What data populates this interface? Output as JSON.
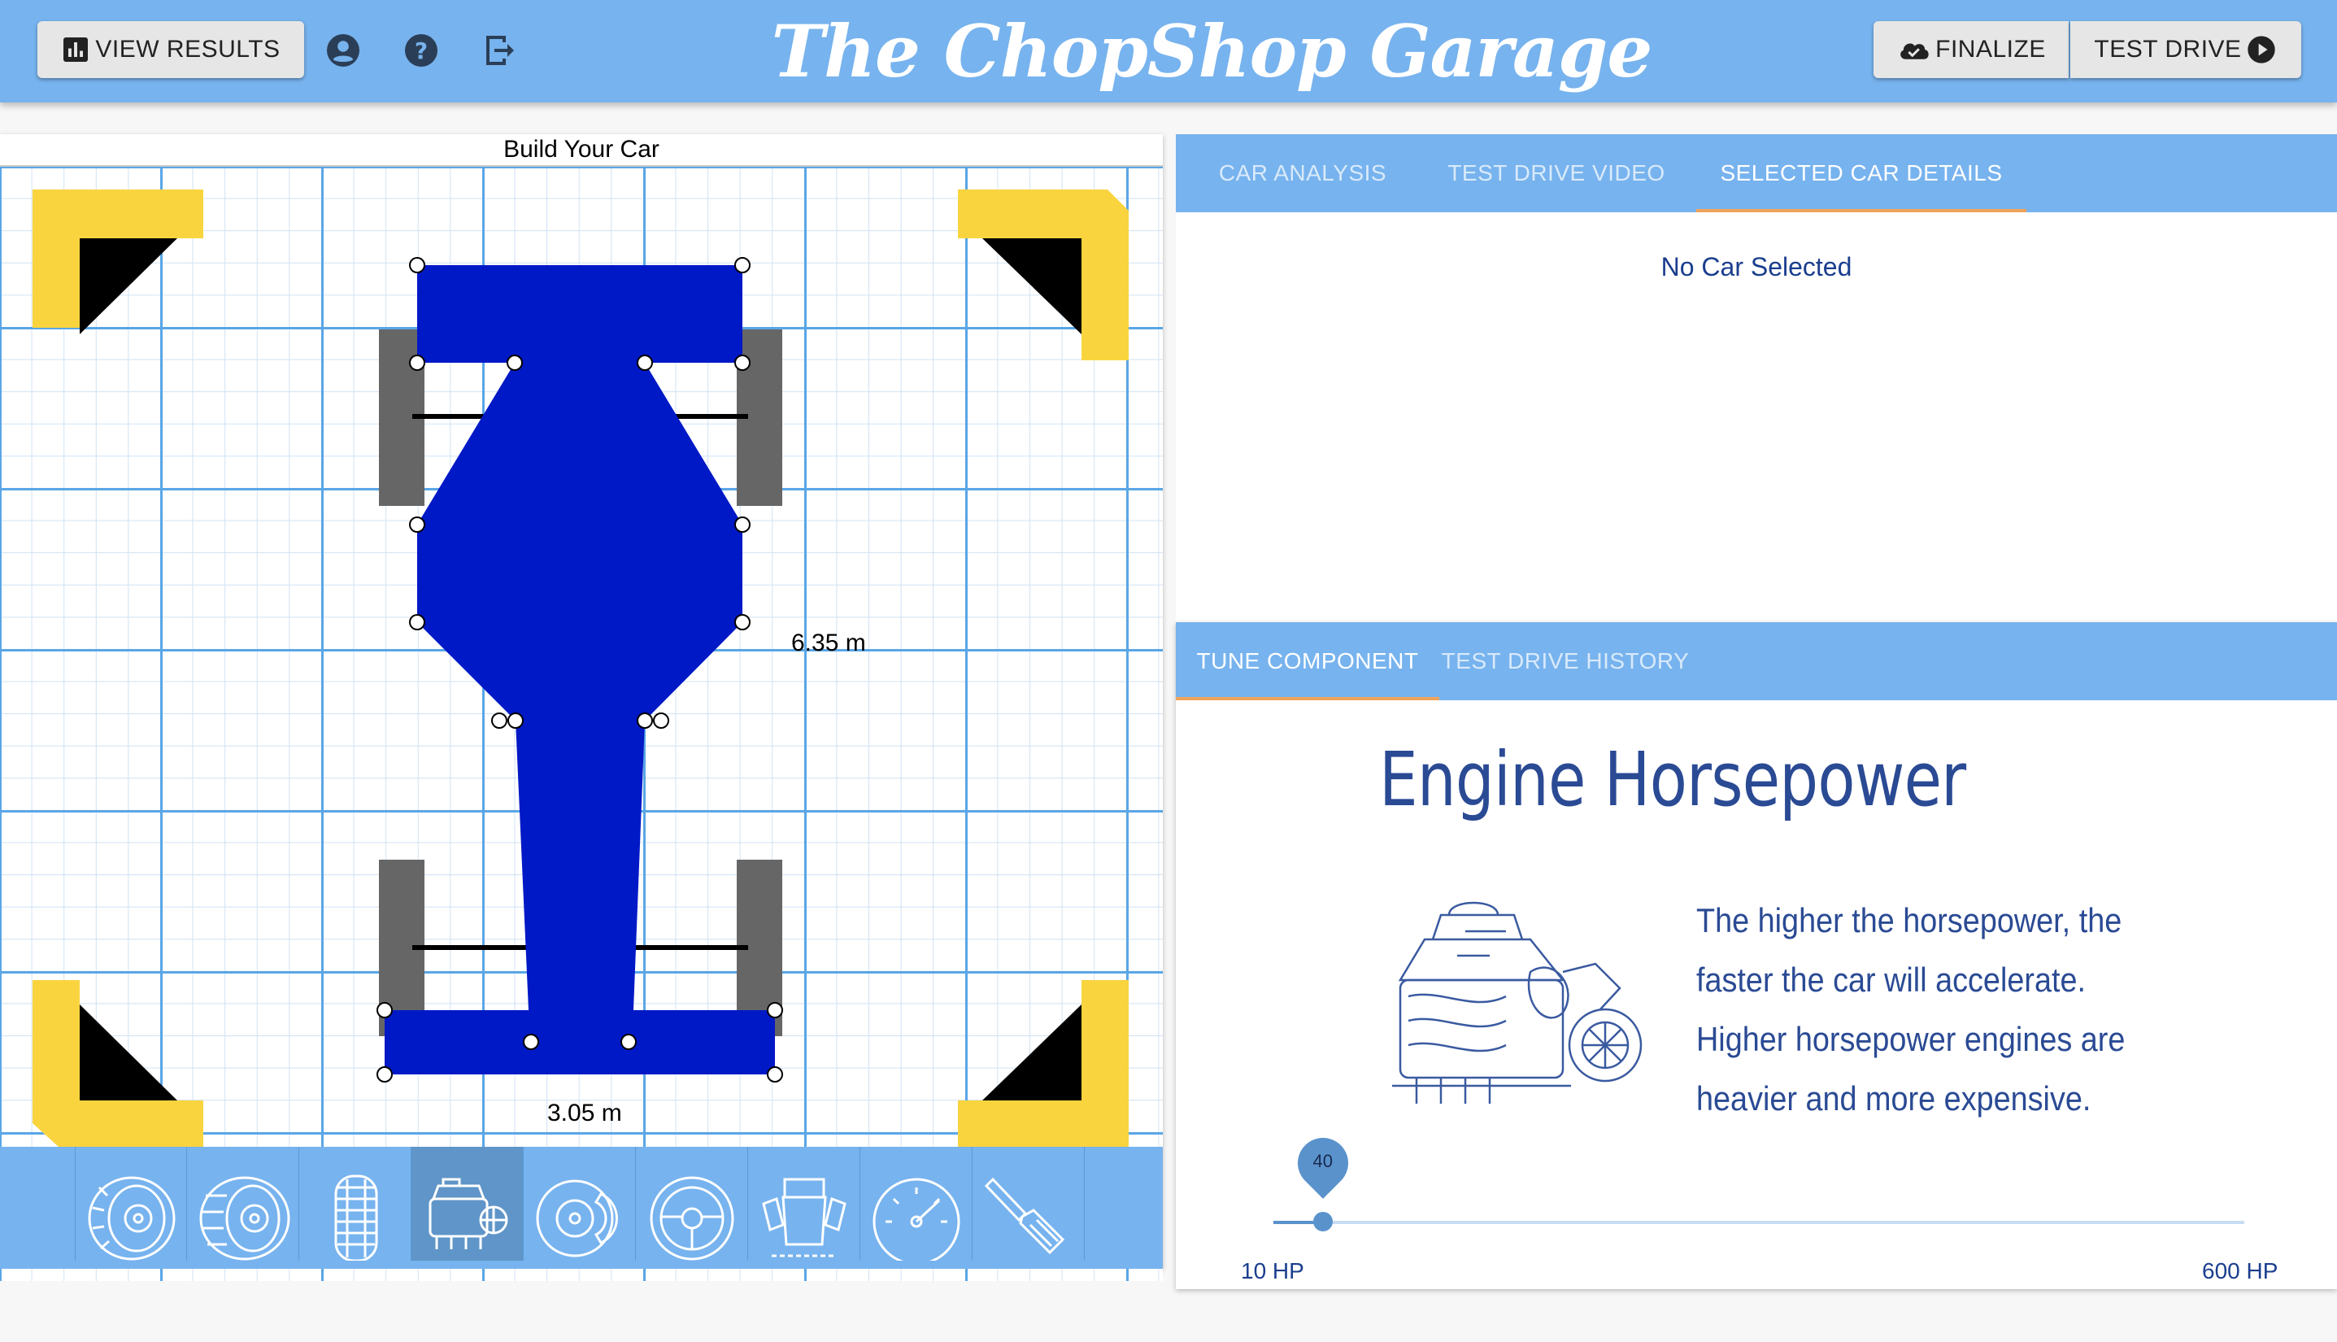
{
  "header": {
    "title": "The ChopShop Garage",
    "view_results_label": "VIEW RESULTS",
    "finalize_label": "FINALIZE",
    "test_drive_label": "TEST DRIVE",
    "icons": [
      "bar-chart-icon",
      "account-icon",
      "help-icon",
      "logout-icon",
      "cloud-check-icon",
      "play-circle-icon"
    ]
  },
  "builder": {
    "title": "Build Your Car",
    "length_label": "6.35 m",
    "width_label": "3.05 m",
    "car_color": "#0019c6",
    "tire_color": "#666666",
    "corner_marker_color": "#f9d43f"
  },
  "parts": [
    {
      "name": "tire",
      "icon": "tire-icon"
    },
    {
      "name": "wide-tire",
      "icon": "wide-tire-icon"
    },
    {
      "name": "offroad-tire",
      "icon": "offroad-tire-icon"
    },
    {
      "name": "engine",
      "icon": "engine-icon",
      "selected": true
    },
    {
      "name": "brakes",
      "icon": "brake-disc-icon"
    },
    {
      "name": "steering",
      "icon": "steering-wheel-icon"
    },
    {
      "name": "chassis",
      "icon": "chassis-icon"
    },
    {
      "name": "speedometer",
      "icon": "speedometer-icon"
    },
    {
      "name": "paint",
      "icon": "paintbrush-icon"
    }
  ],
  "info_tabs": {
    "tabs": [
      "CAR ANALYSIS",
      "TEST DRIVE VIDEO",
      "SELECTED CAR DETAILS"
    ],
    "active": "SELECTED CAR DETAILS",
    "empty_message": "No Car Selected"
  },
  "tune_tabs": {
    "tabs": [
      "TUNE COMPONENT",
      "TEST DRIVE HISTORY"
    ],
    "active": "TUNE COMPONENT"
  },
  "tune": {
    "heading": "Engine Horsepower",
    "description_lines": [
      "The higher the horsepower, the",
      "faster the car will accelerate.",
      "Higher horsepower engines are",
      "heavier and more expensive."
    ],
    "slider": {
      "value": 40,
      "value_label": "40",
      "min": 10,
      "max": 600,
      "min_label": "10 HP",
      "max_label": "600 HP"
    }
  },
  "colors": {
    "header_blue": "#77b3ee",
    "accent_orange": "#f0a35a",
    "text_navy": "#1a3e8e"
  }
}
